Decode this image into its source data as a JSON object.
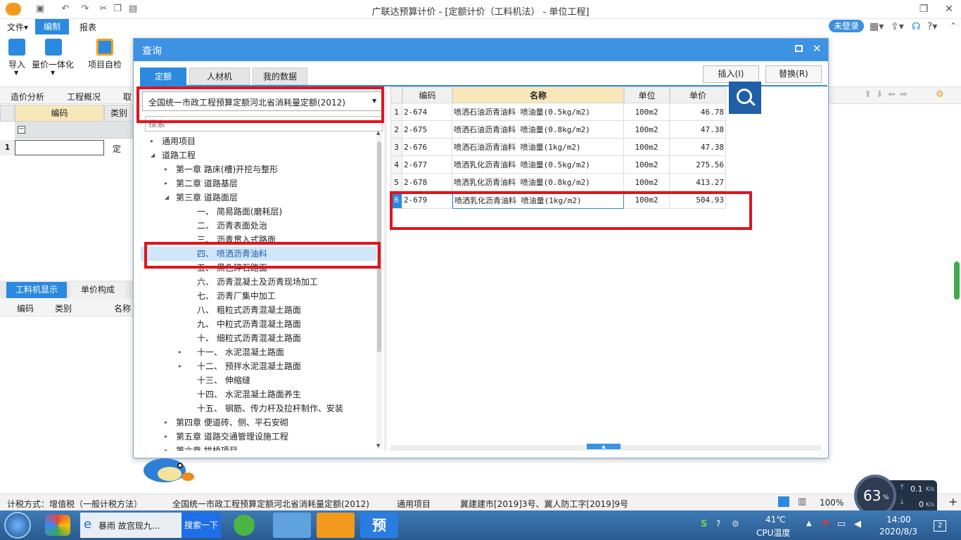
{
  "app": {
    "title": "广联达预算计价 - [定额计价（工料机法） - 单位工程]"
  },
  "menu": {
    "file": "文件▾",
    "edit": "编制",
    "report": "报表",
    "login": "未登录"
  },
  "ribbon": {
    "import": "导入",
    "unify": "量价一体化",
    "check": "项目自检"
  },
  "subtabs": [
    "造价分析",
    "工程概况",
    "取"
  ],
  "grid": {
    "col_code": "编码",
    "col_type": "类别",
    "row1_no": "1",
    "row1_type": "定"
  },
  "bottom": {
    "tab1": "工料机显示",
    "tab2": "单价构成",
    "col_code": "编码",
    "col_type": "类别",
    "col_name": "名称"
  },
  "dialog": {
    "title": "查询",
    "tabs": [
      "定额",
      "人材机",
      "我的数据"
    ],
    "insert": "插入(I)",
    "replace": "替换(R)",
    "library": "全国统一市政工程预算定额河北省消耗量定额(2012)",
    "search_placeholder": "搜索",
    "tree": [
      {
        "label": "通用项目",
        "level": 0,
        "arrow": "▸"
      },
      {
        "label": "道路工程",
        "level": 0,
        "arrow": "◢"
      },
      {
        "label": "第一章  路床(槽)开挖与整形",
        "level": 1,
        "arrow": "▸"
      },
      {
        "label": "第二章  道路基层",
        "level": 1,
        "arrow": "▸"
      },
      {
        "label": "第三章  道路面层",
        "level": 1,
        "arrow": "◢"
      },
      {
        "label": "一、  简易路面(磨耗层)",
        "level": 2,
        "arrow": ""
      },
      {
        "label": "二、  沥青表面处治",
        "level": 2,
        "arrow": ""
      },
      {
        "label": "三、  沥青贯入式路面",
        "level": 2,
        "arrow": ""
      },
      {
        "label": "四、  喷洒沥青油料",
        "level": 2,
        "arrow": "",
        "selected": true
      },
      {
        "label": "五、  黑色碎石路面",
        "level": 2,
        "arrow": ""
      },
      {
        "label": "六、  沥青混凝土及沥青现场加工",
        "level": 2,
        "arrow": ""
      },
      {
        "label": "七、  沥青厂集中加工",
        "level": 2,
        "arrow": ""
      },
      {
        "label": "八、  粗粒式沥青混凝土路面",
        "level": 2,
        "arrow": ""
      },
      {
        "label": "九、  中粒式沥青混凝土路面",
        "level": 2,
        "arrow": ""
      },
      {
        "label": "十、  细粒式沥青混凝土路面",
        "level": 2,
        "arrow": ""
      },
      {
        "label": "十一、  水泥混凝土路面",
        "level": 2,
        "arrow": "▸"
      },
      {
        "label": "十二、  预拌水泥混凝土路面",
        "level": 2,
        "arrow": "▸"
      },
      {
        "label": "十三、  伸缩缝",
        "level": 2,
        "arrow": ""
      },
      {
        "label": "十四、  水泥混凝土路面养生",
        "level": 2,
        "arrow": ""
      },
      {
        "label": "十五、  钢筋、传力杆及拉杆制作、安装",
        "level": 2,
        "arrow": ""
      },
      {
        "label": "第四章  便道砖、侧、平石安砌",
        "level": 1,
        "arrow": "▸"
      },
      {
        "label": "第五章  道路交通管理设施工程",
        "level": 1,
        "arrow": "▸"
      },
      {
        "label": "第六章  拱桥项目",
        "level": 1,
        "arrow": "▸"
      }
    ],
    "table": {
      "headers": [
        "编码",
        "名称",
        "单位",
        "单价"
      ],
      "rows": [
        {
          "no": "1",
          "code": "2-674",
          "name": "喷洒石油沥青油料 喷油量(0.5kg/m2)",
          "unit": "100m2",
          "price": "46.78"
        },
        {
          "no": "2",
          "code": "2-675",
          "name": "喷洒石油沥青油料 喷油量(0.8kg/m2)",
          "unit": "100m2",
          "price": "47.38"
        },
        {
          "no": "3",
          "code": "2-676",
          "name": "喷洒石油沥青油料 喷油量(1kg/m2)",
          "unit": "100m2",
          "price": "47.38"
        },
        {
          "no": "4",
          "code": "2-677",
          "name": "喷洒乳化沥青油料 喷油量(0.5kg/m2)",
          "unit": "100m2",
          "price": "275.56"
        },
        {
          "no": "5",
          "code": "2-678",
          "name": "喷洒乳化沥青油料 喷油量(0.8kg/m2)",
          "unit": "100m2",
          "price": "413.27"
        },
        {
          "no": "6",
          "code": "2-679",
          "name": "喷洒乳化沥青油料 喷油量(1kg/m2)",
          "unit": "100m2",
          "price": "504.93"
        }
      ]
    }
  },
  "status": {
    "tax": "计税方式：增值税（一般计税方法）",
    "library": "全国统一市政工程预算定额河北省消耗量定额(2012)",
    "section": "通用项目",
    "doc": "冀建建市[2019]3号、冀人防工字[2019]9号",
    "zoom": "100%",
    "gauge": "63",
    "gauge_unit": "%",
    "up": "0.1",
    "down": "0",
    "rate_unit": "K/s"
  },
  "taskbar": {
    "ie_text": "暴雨 故宫现九...",
    "search_btn": "搜索一下",
    "yu": "预",
    "temp": "41℃",
    "cpu": "CPU温度",
    "time": "14:00",
    "date": "2020/8/3",
    "badge": "2"
  },
  "colors": {
    "accent": "#3c92e3",
    "highlight": "#e0141e",
    "selected": "#cfe6fb"
  }
}
